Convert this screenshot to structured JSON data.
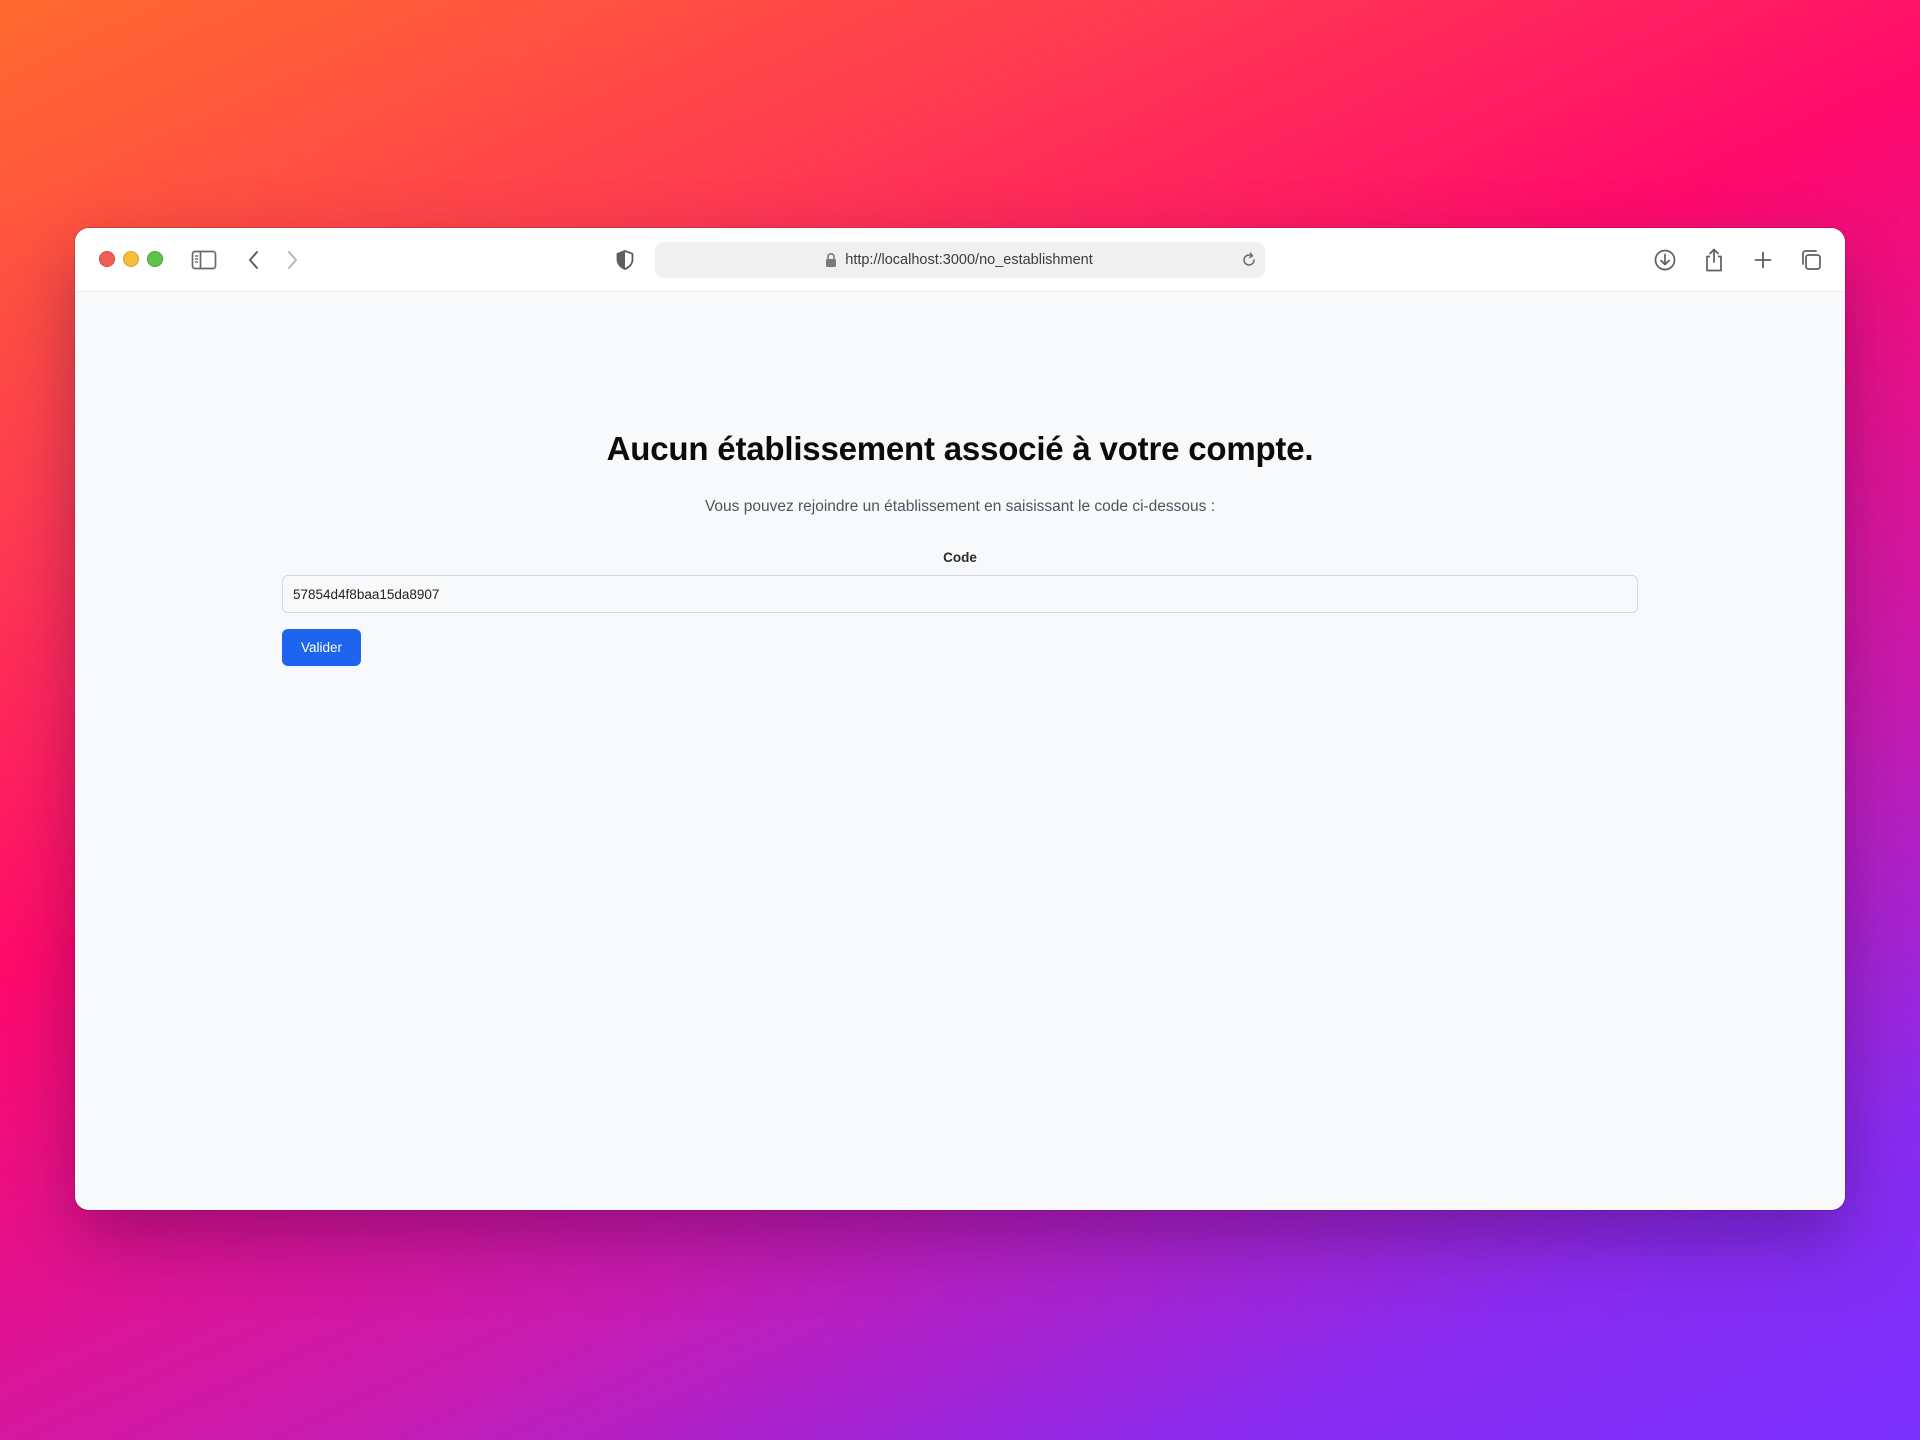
{
  "browser": {
    "url": "http://localhost:3000/no_establishment",
    "icons": {
      "close": "close-window-icon",
      "minimize": "minimize-window-icon",
      "maximize": "maximize-window-icon",
      "sidebar": "sidebar-icon",
      "back": "chevron-left-icon",
      "forward": "chevron-right-icon",
      "privacy": "shield-icon",
      "lock": "lock-icon",
      "reload": "reload-icon",
      "download": "download-icon",
      "share": "share-icon",
      "new_tab": "plus-icon",
      "tabs_overview": "tabs-icon"
    }
  },
  "page": {
    "title": "Aucun établissement associé à votre compte.",
    "subtitle": "Vous pouvez rejoindre un établissement en saisissant le code ci-dessous :",
    "form": {
      "code_label": "Code",
      "code_value": "57854d4f8baa15da8907",
      "submit_label": "Valider"
    }
  },
  "colors": {
    "primary_button": "#1d64ee",
    "page_background": "#f8f9fb"
  }
}
